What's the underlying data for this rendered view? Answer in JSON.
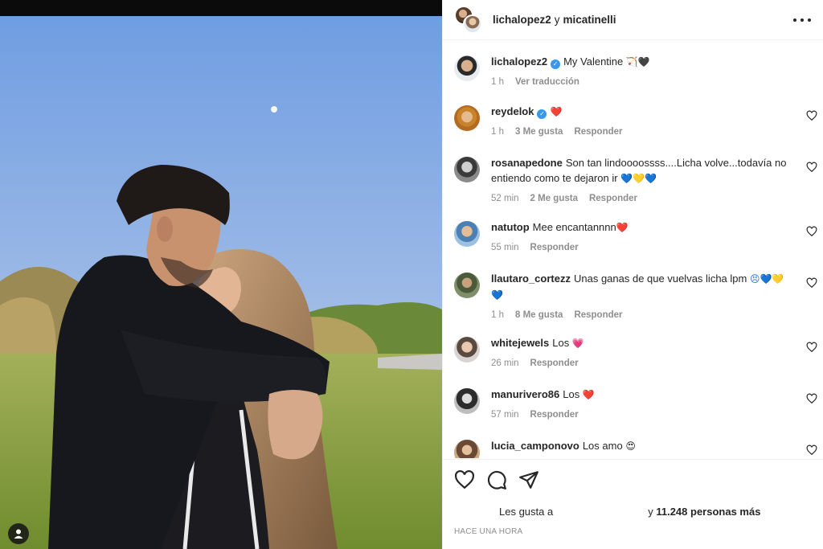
{
  "header": {
    "user1": "lichalopez2",
    "conjunction": "y",
    "user2": "micatinelli"
  },
  "caption": {
    "user": "lichalopez2",
    "text": "My Valentine",
    "emoji": "🏹🖤",
    "time": "1 h",
    "translate": "Ver traducción"
  },
  "comments": [
    {
      "user": "reydelok",
      "verified": true,
      "text": "",
      "emoji": "❤️",
      "time": "1 h",
      "likes": "3 Me gusta",
      "reply": "Responder"
    },
    {
      "user": "rosanapedone",
      "verified": false,
      "text": "Son tan lindoooossss....Licha volve...todavía no entiendo como te dejaron ir",
      "emoji": "💙💛💙",
      "time": "52 min",
      "likes": "2 Me gusta",
      "reply": "Responder"
    },
    {
      "user": "natutop",
      "verified": false,
      "text": "Mee encantannnn",
      "emoji": "❤️",
      "time": "55 min",
      "likes": "",
      "reply": "Responder"
    },
    {
      "user": "llautaro_cortezz",
      "verified": false,
      "text": "Unas ganas de que vuelvas licha lpm",
      "emoji": "😣💙💛💙",
      "time": "1 h",
      "likes": "8 Me gusta",
      "reply": "Responder"
    },
    {
      "user": "whitejewels",
      "verified": false,
      "text": "Los",
      "emoji": "💗",
      "time": "26 min",
      "likes": "",
      "reply": "Responder"
    },
    {
      "user": "manurivero86",
      "verified": false,
      "text": "Los",
      "emoji": "❤️",
      "time": "57 min",
      "likes": "",
      "reply": "Responder"
    },
    {
      "user": "lucia_camponovo",
      "verified": false,
      "text": "Los amo",
      "emoji": "😍",
      "time": "",
      "likes": "",
      "reply": ""
    }
  ],
  "footer": {
    "likes_prefix": "Les gusta a",
    "likes_mid": "y",
    "likes_count": "11.248 personas más",
    "time_ago": "HACE UNA HORA"
  },
  "icons": [
    "like-icon",
    "comment-icon",
    "share-icon",
    "more-options-icon",
    "verified-icon",
    "comment-like-icon",
    "tagged-user-icon"
  ],
  "colors": {
    "verified": "#3897f0",
    "secondary_text": "#8e8e8e",
    "border": "#efefef",
    "sky_top": "#6d9be0",
    "grass": "#8fa53c"
  }
}
